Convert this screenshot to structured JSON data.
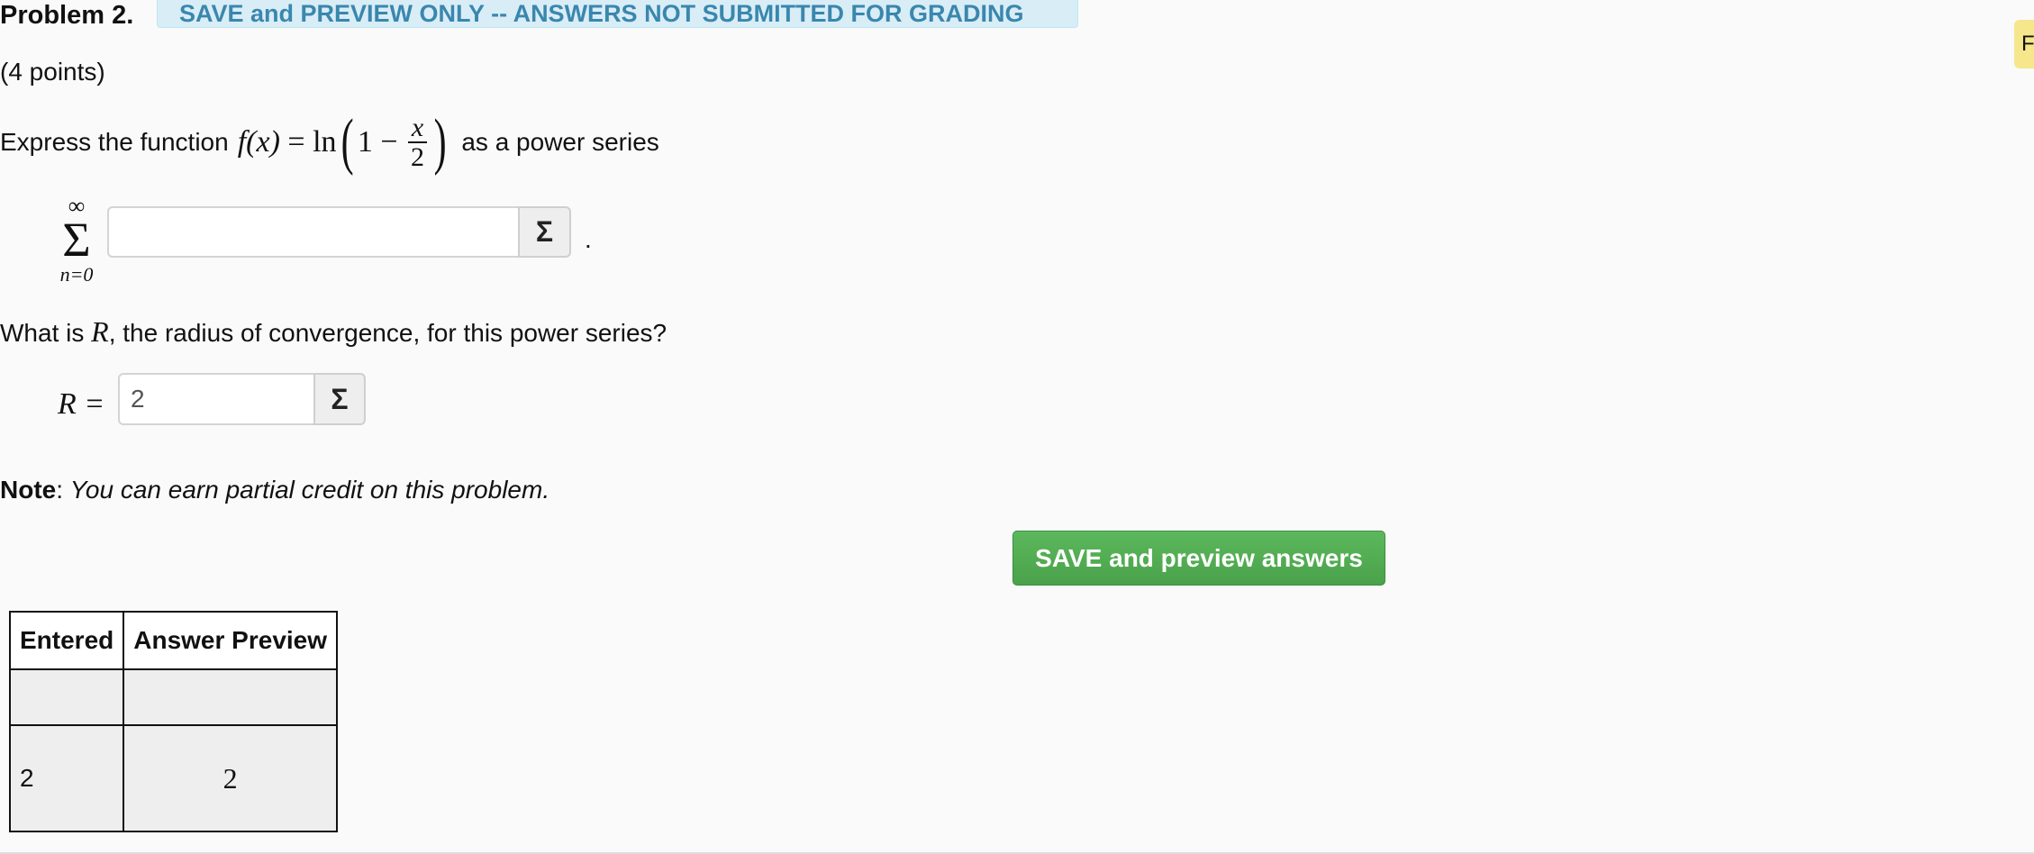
{
  "problem": {
    "title": "Problem 2.",
    "banner": "SAVE and PREVIEW ONLY -- ANSWERS NOT SUBMITTED FOR GRADING",
    "side_tab": "F",
    "points": "(4 points)"
  },
  "question1": {
    "prefix": "Express the function",
    "function_lhs": "f(x)",
    "equals": "=",
    "ln": "ln",
    "one": "1",
    "minus": "−",
    "frac_num": "x",
    "frac_den": "2",
    "suffix": "as a power series"
  },
  "series": {
    "upper": "∞",
    "sigma": "Σ",
    "lower": "n=0",
    "input_value": "",
    "button_label": "Σ",
    "trailing": "."
  },
  "question2": {
    "prefix": "What is",
    "variable": "R",
    "suffix": ", the radius of convergence, for this power series?"
  },
  "radius": {
    "label": "R =",
    "input_value": "2",
    "button_label": "Σ"
  },
  "note": {
    "label": "Note",
    "colon": ":",
    "text": "You can earn partial credit on this problem."
  },
  "actions": {
    "save_label": "SAVE and preview answers"
  },
  "answers_table": {
    "headers": [
      "Entered",
      "Answer Preview"
    ],
    "rows": [
      {
        "entered": "",
        "preview": ""
      },
      {
        "entered": "2",
        "preview": "2"
      }
    ]
  },
  "colors": {
    "banner_bg": "#d9edf7",
    "banner_text": "#3a87ad",
    "save_button": "#5cb85c",
    "side_tab": "#f6e68c"
  }
}
